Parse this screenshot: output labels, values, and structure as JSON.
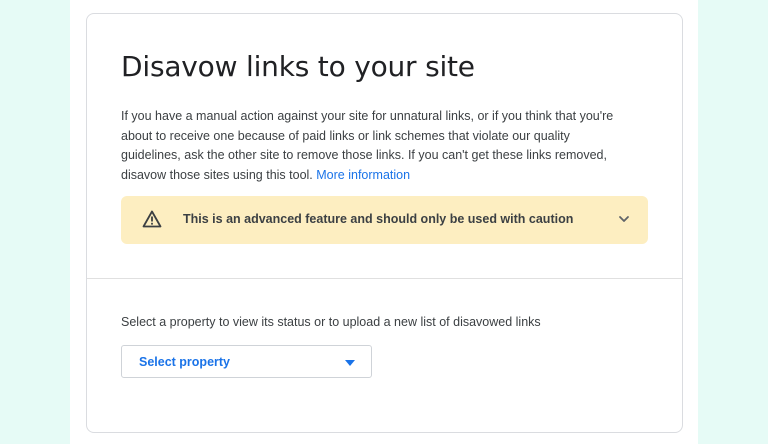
{
  "page": {
    "title": "Disavow links to your site",
    "description": "If you have a manual action against your site for unnatural links, or if you think that you're about to receive one because of paid links or link schemes that violate our quality guidelines, ask the other site to remove those links. If you can't get these links removed, disavow those sites using this tool.",
    "more_info_link": "More information"
  },
  "warning": {
    "icon": "warning-triangle-icon",
    "text": "This is an advanced feature and should only be used with caution",
    "expand_icon": "chevron-down-icon"
  },
  "property": {
    "prompt": "Select a property to view its status or to upload a new list of disavowed links",
    "select_label": "Select property",
    "select_icon": "caret-down-icon"
  },
  "colors": {
    "background": "#e6fbf6",
    "link": "#1a73e8",
    "warning_bg": "#fdeec1",
    "text": "#3c4043",
    "heading": "#202124"
  }
}
